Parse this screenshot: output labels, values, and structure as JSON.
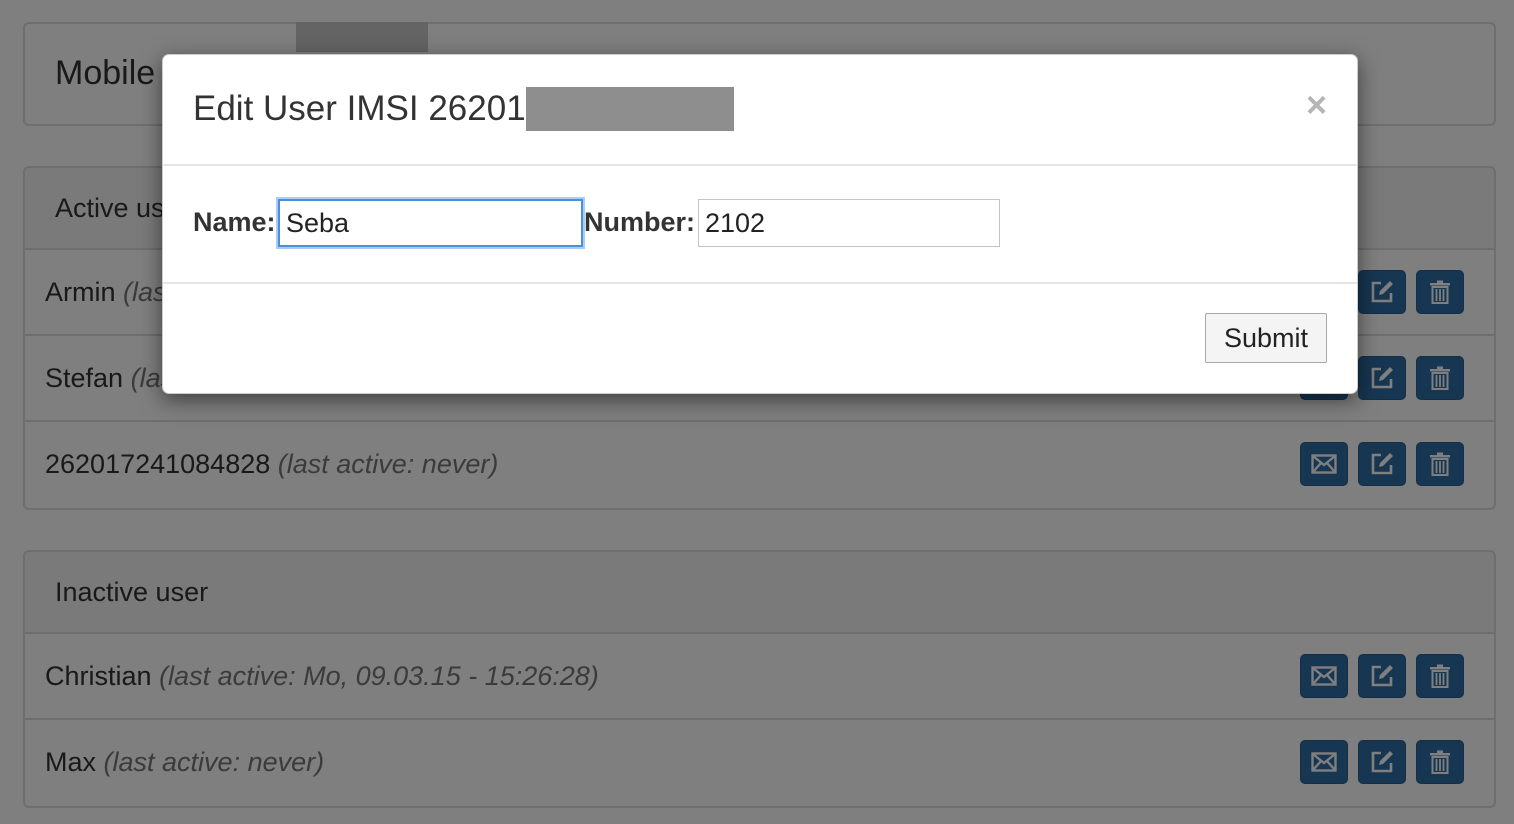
{
  "background": {
    "title": "Mobile",
    "active_panel": {
      "heading": "Active user",
      "rows": [
        {
          "name": "Armin",
          "meta": "(last active: ...)"
        },
        {
          "name": "Stefan",
          "meta": "(last active: ...)"
        },
        {
          "name": "262017241084828",
          "meta": "(last active: never)"
        }
      ]
    },
    "inactive_panel": {
      "heading": "Inactive user",
      "rows": [
        {
          "name": "Christian",
          "meta": "(last active: Mo, 09.03.15 - 15:26:28)"
        },
        {
          "name": "Max",
          "meta": "(last active: never)"
        }
      ]
    },
    "row_action_icons": [
      "envelope-icon",
      "edit-icon",
      "trash-icon"
    ]
  },
  "modal": {
    "title": "Edit User IMSI 26201",
    "close_glyph": "×",
    "name_label": "Name:",
    "name_value": "Seba",
    "number_label": "Number:",
    "number_value": "2102",
    "submit_label": "Submit"
  },
  "colors": {
    "action_button": "#2f6ca3",
    "focus_ring": "#4a90d9",
    "redaction": "#8e8e8e"
  }
}
